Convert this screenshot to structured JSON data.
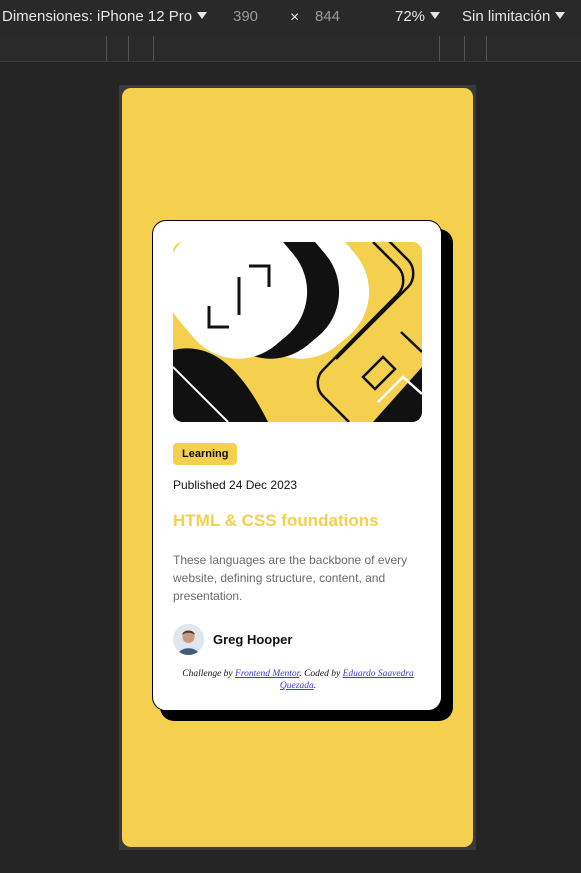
{
  "toolbar": {
    "dimensions_label": "Dimensiones: iPhone 12 Pro",
    "width": "390",
    "times": "×",
    "height": "844",
    "zoom": "72%",
    "throttle": "Sin limitación"
  },
  "card": {
    "tag": "Learning",
    "published": "Published 24 Dec 2023",
    "title": "HTML & CSS foundations",
    "description": "These languages are the backbone of every website, defining structure, content, and presentation.",
    "author": "Greg Hooper",
    "attribution": {
      "prefix": "Challenge by ",
      "link1": "Frontend Mentor",
      "middle": ". Coded by ",
      "link2": "Eduardo Saavedra Quezada",
      "suffix": "."
    }
  },
  "colors": {
    "accent": "#f4d04e",
    "page_bg": "#252525",
    "text": "#111111"
  },
  "icons": [
    "caret-down-icon",
    "close-icon"
  ]
}
